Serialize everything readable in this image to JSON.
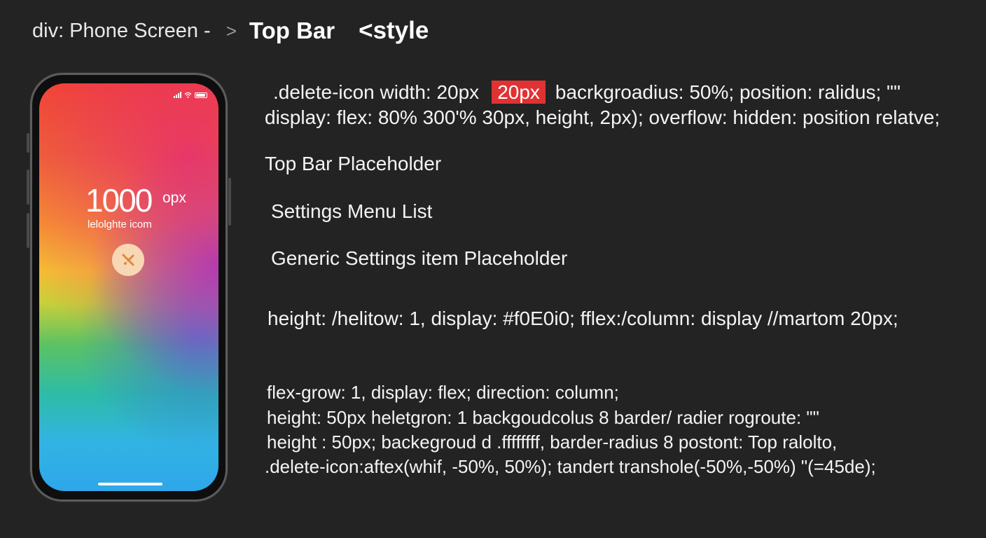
{
  "header": {
    "breadcrumb_root": "div: Phone Screen -",
    "separator": ">",
    "current": "Top Bar",
    "style_tag": "<style"
  },
  "phone": {
    "big_number": "1000",
    "big_unit": "opx",
    "label": "lelolghte icom",
    "center_icon": "delete-icon"
  },
  "code": {
    "line1_prefix": ".delete-icon  width: 20px",
    "line1_highlight": "20px",
    "line1_suffix": "bacrkgroadius: 50%; position: ralidus;  \"\"",
    "line2": "display: flex: 80% 300'% 30px, height, 2px); overflow: hidden: position relatve;",
    "line3": "Top Bar Placeholder",
    "line4": "Settings Menu List",
    "line5": "Generic Settings item Placeholder",
    "line6": "height: /helitow: 1, display: #f0E0i0; fflex:/column: display //martom 20px;",
    "line7": "flex-grow: 1, display: flex; direction: column;",
    "line8": "height: 50px heletgron: 1 backgoudcolus 8 barder/ radier rogroute:  \"\"",
    "line9": "height : 50px; backegroud d .ffffffff, barder-radius 8 postont: Top ralolto,",
    "line10": ".delete-icon:aftex(whif, -50%, 50%); tandert transhole(-50%,-50%)  \"(=45de);"
  },
  "colors": {
    "background": "#232323",
    "highlight": "#e03232",
    "text": "#f4f4f4"
  }
}
